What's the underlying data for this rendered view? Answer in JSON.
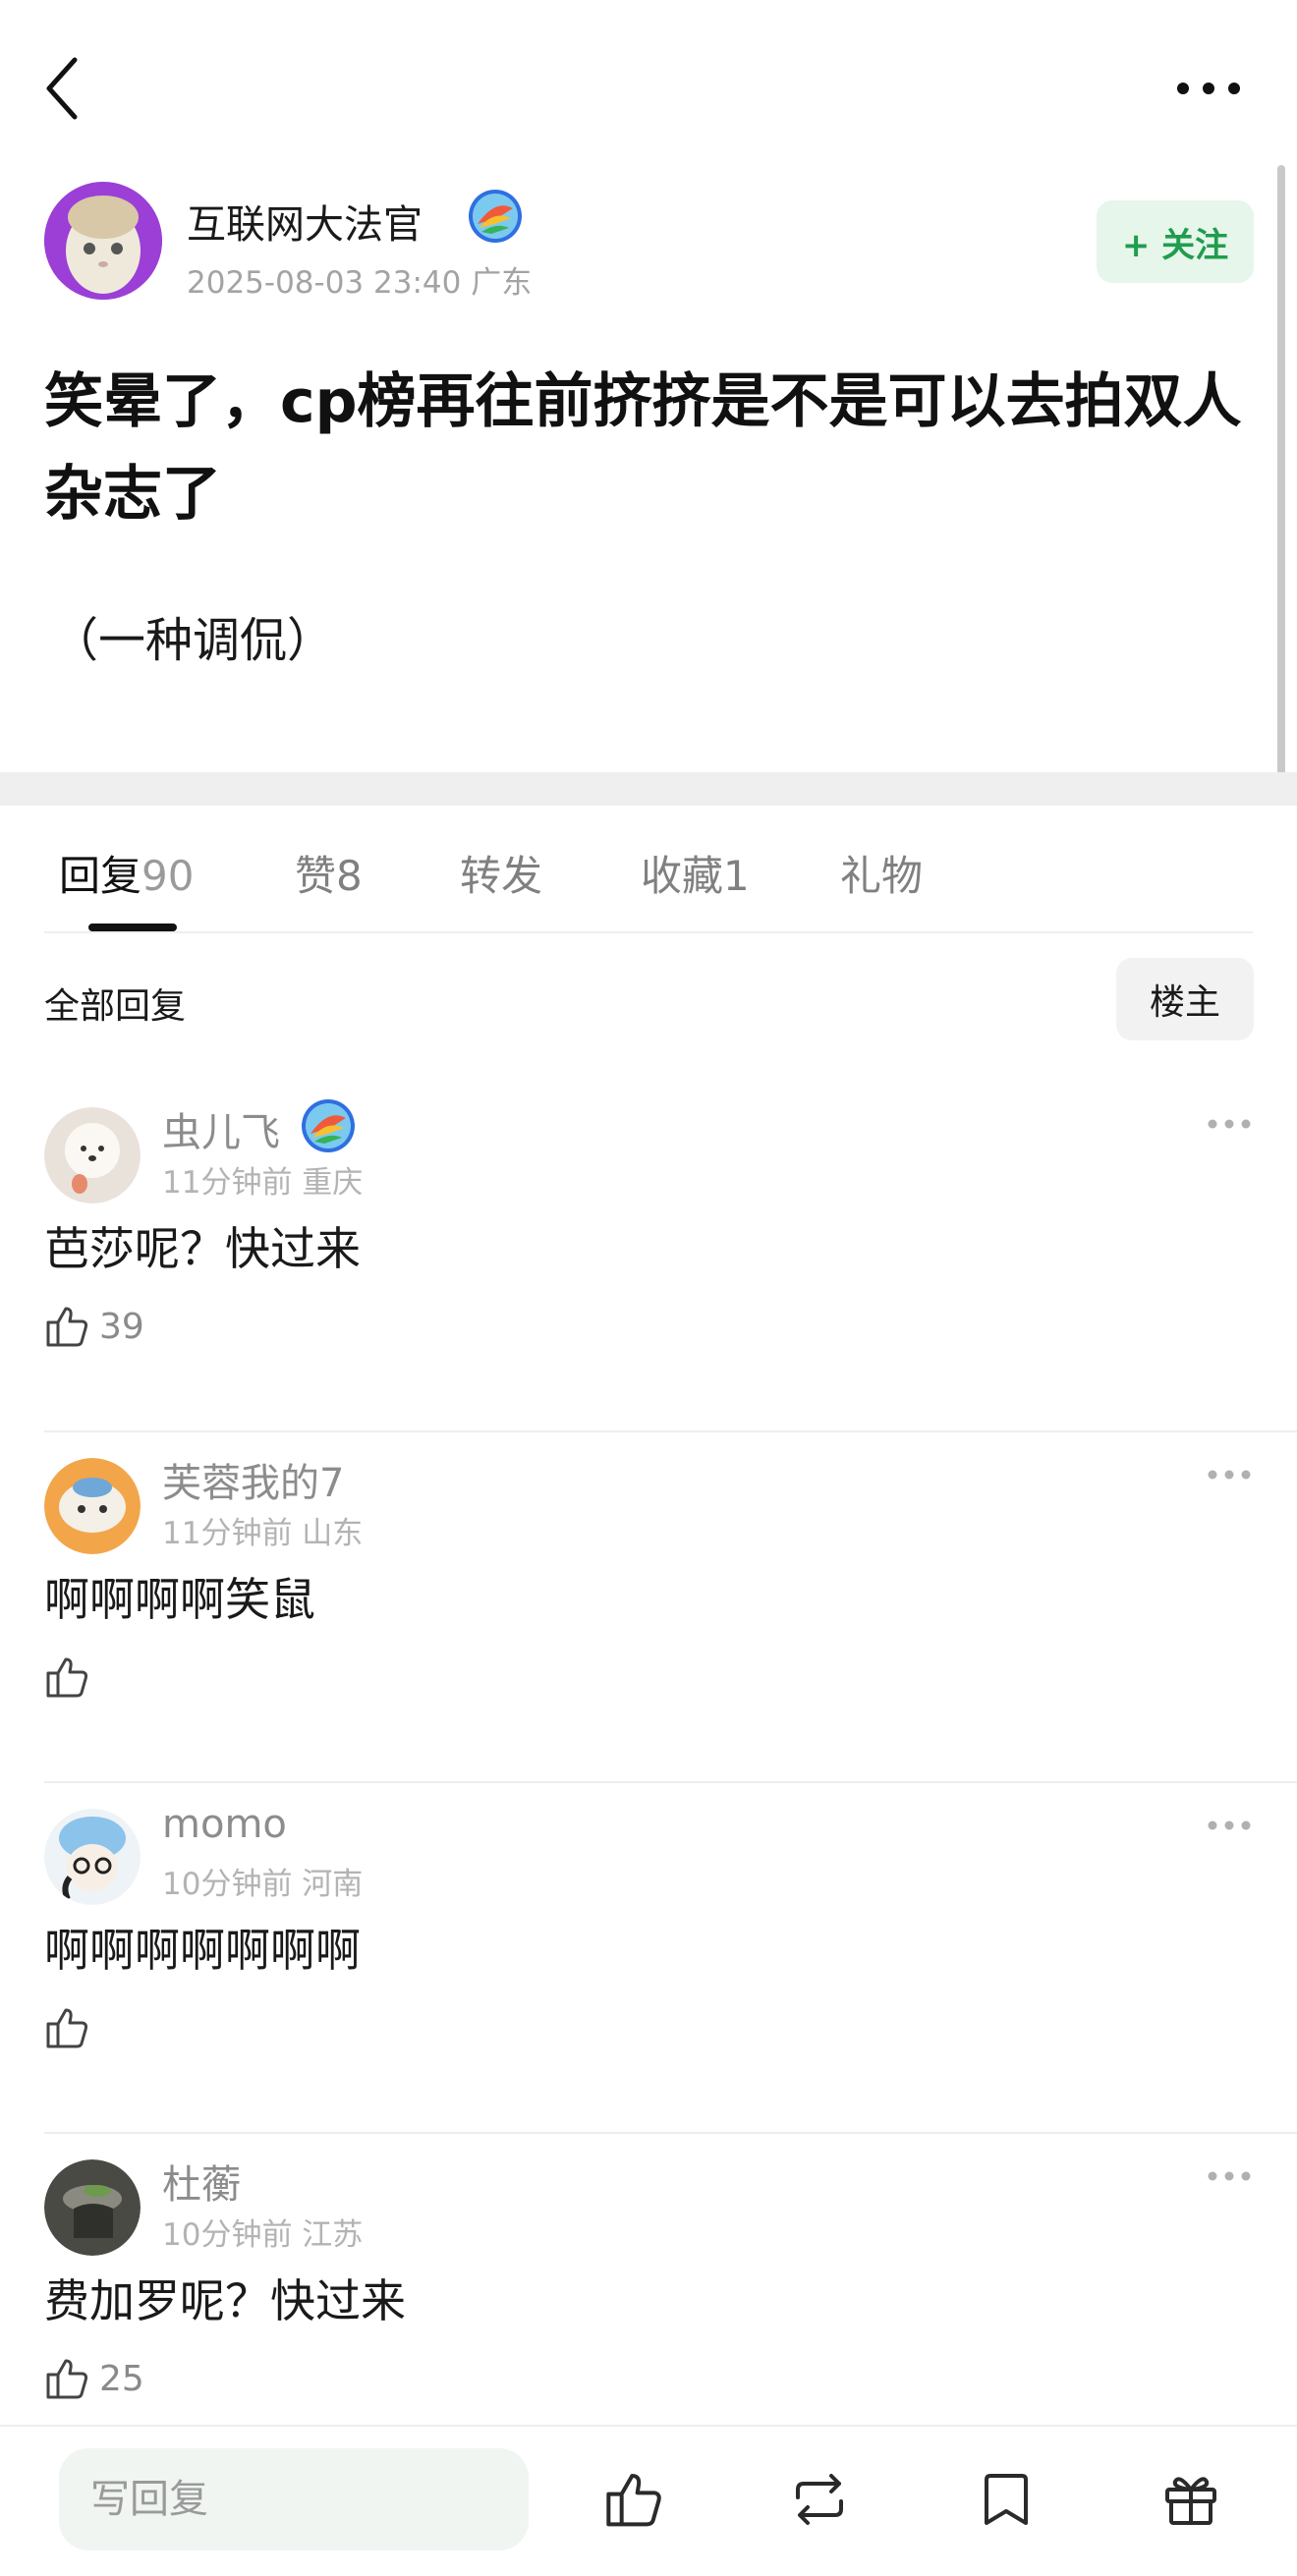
{
  "post": {
    "author": {
      "name": "互联网大法官",
      "meta": "2025-08-03 23:40  广东",
      "follow_label": "+ 关注"
    },
    "title": "笑晕了，cp榜再往前挤挤是不是可以去拍双人杂志了",
    "body": "（一种调侃）"
  },
  "tabs": [
    {
      "label": "回复",
      "count": "90"
    },
    {
      "label": "赞",
      "count": "8"
    },
    {
      "label": "转发",
      "count": ""
    },
    {
      "label": "收藏",
      "count": "1"
    },
    {
      "label": "礼物",
      "count": ""
    }
  ],
  "replies_header": {
    "title": "全部回复",
    "op_filter": "楼主"
  },
  "comments": [
    {
      "name": "虫儿飞",
      "meta": "11分钟前 重庆",
      "text": "芭莎呢？快过来",
      "likes": "39"
    },
    {
      "name": "芙蓉我的7",
      "meta": "11分钟前 山东",
      "text": "啊啊啊啊笑鼠",
      "likes": ""
    },
    {
      "name": "momo",
      "meta": "10分钟前 河南",
      "text": "啊啊啊啊啊啊啊",
      "likes": ""
    },
    {
      "name": "杜蘅",
      "meta": "10分钟前 江苏",
      "text": "费加罗呢？快过来",
      "likes": "25"
    }
  ],
  "bottom_bar": {
    "reply_placeholder": "写回复",
    "icons": [
      "like-icon",
      "repost-icon",
      "bookmark-icon",
      "gift-icon"
    ]
  },
  "colors": {
    "accent_green": "#1f9d4f",
    "follow_bg": "#e6f6ea",
    "secondary_text": "#a3a3a3"
  }
}
